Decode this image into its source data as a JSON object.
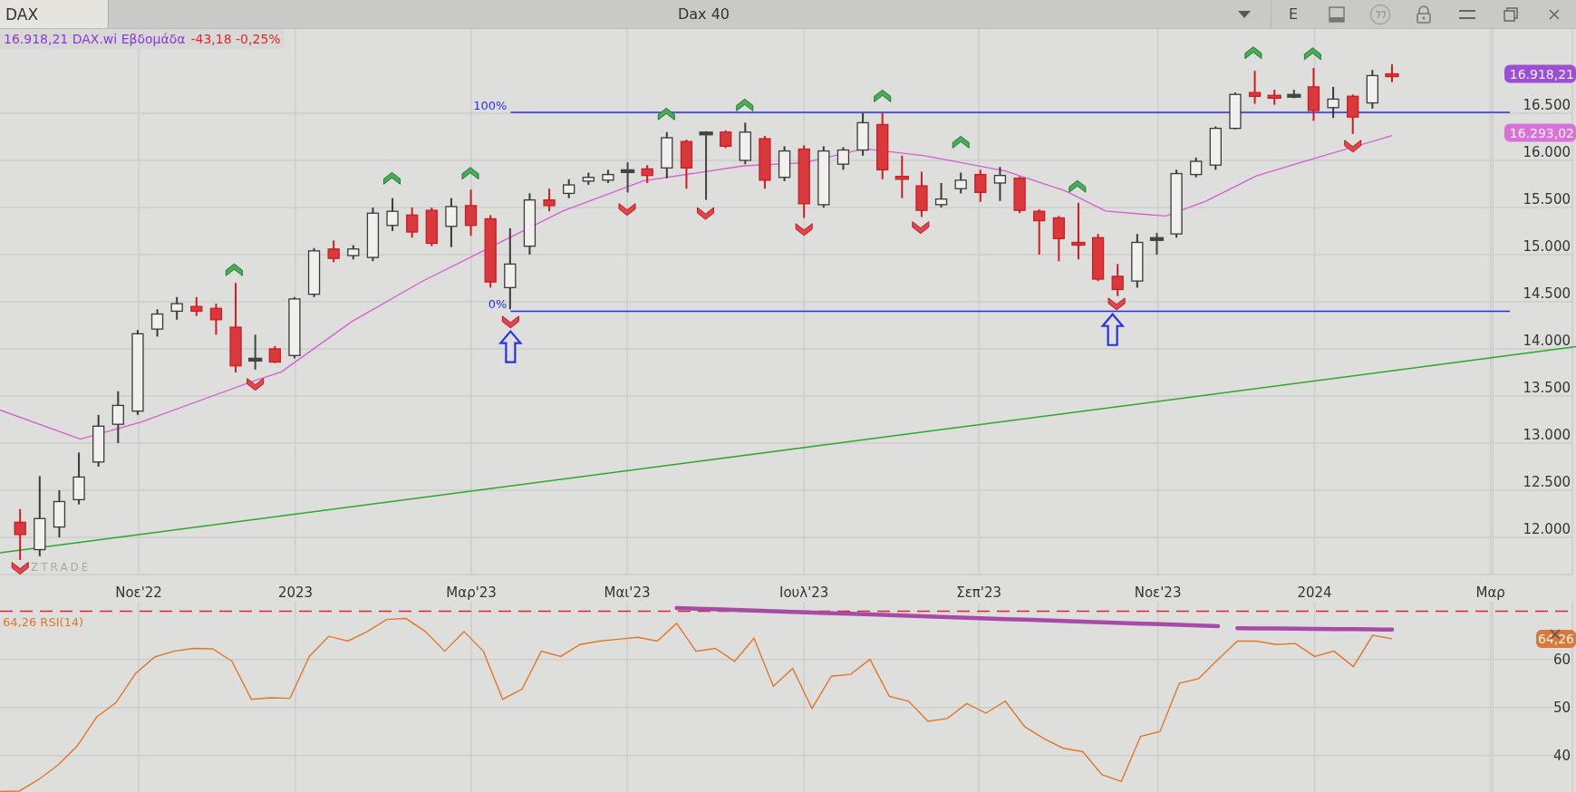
{
  "tab": {
    "label": "DAX",
    "selected": true
  },
  "title": "Dax 40",
  "toolbar": {
    "letter": "E"
  },
  "legend": {
    "quote": "16.918,21 DAX.wi Εβδομάδα",
    "change": "-43,18 -0,25%"
  },
  "price_axis": {
    "ticks": [
      "16.500",
      "16.000",
      "15.500",
      "15.000",
      "14.500",
      "14.000",
      "13.500",
      "13.000",
      "12.500",
      "12.000"
    ],
    "badges": [
      {
        "text": "16.918,21",
        "color": "#9a4fd4"
      },
      {
        "text": "16.293,02",
        "color": "#d872d8"
      }
    ]
  },
  "fib_labels": [
    "100%",
    "0%"
  ],
  "logo": "ZTRADE",
  "time_axis": [
    "Νοε'22",
    "2023",
    "Μαρ'23",
    "Μαι'23",
    "Ιουλ'23",
    "Σεπ'23",
    "Νοε'23",
    "2024",
    "Μαρ"
  ],
  "rsi": {
    "legend_value": "64,26",
    "badge": "64,26",
    "ticks": [
      "60",
      "50",
      "40"
    ],
    "chart_data": {
      "type": "line",
      "grid": true,
      "ylim": [
        32.4,
        72
      ],
      "yticks": [
        40,
        50,
        60
      ],
      "ref_lines": [
        {
          "axis": "y",
          "value": 70,
          "color": "#e0262a"
        }
      ],
      "categories": [
        null,
        null,
        null,
        null,
        null,
        null,
        null,
        null,
        null,
        null,
        null,
        null,
        null,
        null,
        null,
        null,
        null,
        null,
        null,
        null,
        null,
        null,
        null,
        null,
        null,
        null,
        null,
        null,
        null,
        null,
        null,
        null,
        null,
        null,
        null,
        null,
        null,
        null,
        null,
        null,
        null,
        null,
        null,
        null,
        null,
        null,
        null,
        null,
        null,
        null,
        null,
        null,
        null,
        null,
        null,
        null,
        null,
        null,
        null,
        null,
        null,
        null,
        null,
        null,
        null,
        null,
        null,
        null,
        null,
        null,
        null,
        null,
        null
      ],
      "series": [
        {
          "name": "RSI(14)",
          "color": "#e0782c",
          "values": [
            32.5,
            32.6,
            35,
            38,
            42,
            48,
            51,
            57,
            60.5,
            61.7,
            62.3,
            62.2,
            59.6,
            51.7,
            52,
            51.9,
            60.6,
            64.8,
            63.8,
            65.8,
            68.3,
            68.5,
            65.8,
            61.7,
            65.8,
            61.7,
            51.7,
            53.8,
            61.7,
            60.6,
            63.1,
            63.8,
            64.2,
            64.6,
            63.8,
            67.5,
            61.7,
            62.3,
            59.6,
            64.4,
            54.4,
            58.1,
            49.8,
            56.5,
            56.9,
            60,
            52.3,
            51.3,
            47.1,
            47.7,
            50.8,
            48.8,
            51.3,
            46,
            43.5,
            41.5,
            40.8,
            36,
            34.6,
            44,
            45,
            55,
            56,
            60,
            63.8,
            63.8,
            63.1,
            63.3,
            60.6,
            61.7,
            58.5,
            65,
            64.3
          ]
        },
        {
          "color": "#a84aa8",
          "values": [
            null,
            null,
            null,
            null,
            null,
            null,
            null,
            null,
            null,
            null,
            null,
            null,
            null,
            null,
            null,
            null,
            null,
            null,
            null,
            null,
            null,
            null,
            null,
            null,
            null,
            null,
            null,
            null,
            null,
            null,
            null,
            null,
            null,
            null,
            null,
            70.7,
            70.56,
            70.43,
            70.29,
            70.16,
            70.02,
            69.89,
            69.75,
            69.61,
            69.48,
            69.34,
            69.21,
            69.07,
            68.94,
            68.8,
            68.66,
            68.53,
            68.39,
            68.26,
            68.12,
            67.99,
            67.85,
            67.71,
            67.58,
            67.44,
            67.31,
            67.17,
            67.04,
            66.9,
            null,
            null,
            null,
            null,
            null,
            null,
            null,
            null,
            null
          ]
        },
        {
          "color": "#a84aa8",
          "values": [
            null,
            null,
            null,
            null,
            null,
            null,
            null,
            null,
            null,
            null,
            null,
            null,
            null,
            null,
            null,
            null,
            null,
            null,
            null,
            null,
            null,
            null,
            null,
            null,
            null,
            null,
            null,
            null,
            null,
            null,
            null,
            null,
            null,
            null,
            null,
            null,
            null,
            null,
            null,
            null,
            null,
            null,
            null,
            null,
            null,
            null,
            null,
            null,
            null,
            null,
            null,
            null,
            null,
            null,
            null,
            null,
            null,
            null,
            null,
            null,
            null,
            null,
            null,
            null,
            66.5,
            66.46,
            66.43,
            66.39,
            66.35,
            66.31,
            66.28,
            66.24,
            66.2
          ]
        }
      ]
    }
  }
}
